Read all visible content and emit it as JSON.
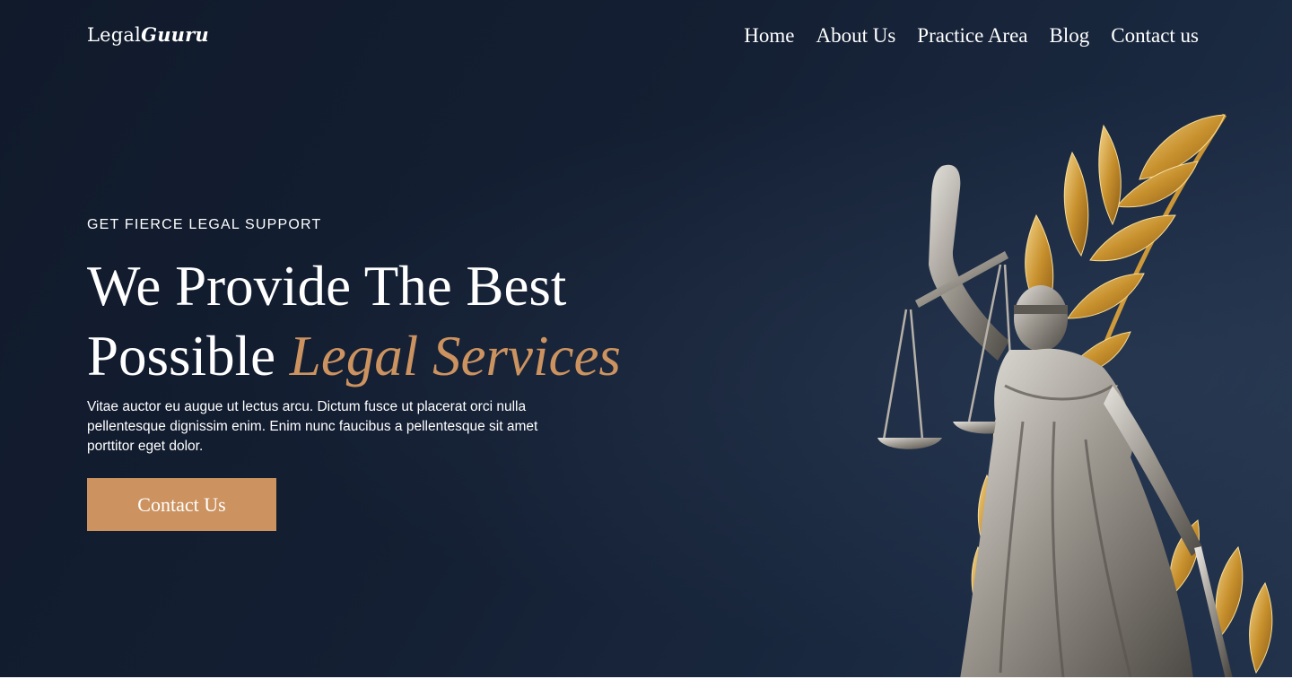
{
  "header": {
    "brand_part1": "Legal",
    "brand_part2": "Guuru",
    "nav": [
      {
        "label": "Home"
      },
      {
        "label": "About Us"
      },
      {
        "label": "Practice Area"
      },
      {
        "label": "Blog"
      },
      {
        "label": "Contact us"
      }
    ]
  },
  "hero": {
    "eyebrow": "GET FIERCE LEGAL SUPPORT",
    "headline_line1": "We Provide The Best",
    "headline_line2_plain": "Possible",
    "headline_line2_accent": "Legal Services",
    "description": "Vitae auctor eu augue ut lectus arcu. Dictum fusce ut placerat orci nulla pellentesque dignissim enim. Enim nunc faucibus a pellentesque sit amet porttitor eget dolor.",
    "cta_label": "Contact Us",
    "image": "lady-justice-statue-with-golden-laurel"
  },
  "colors": {
    "background": "#141f33",
    "accent": "#cc9360",
    "text": "#ffffff"
  }
}
